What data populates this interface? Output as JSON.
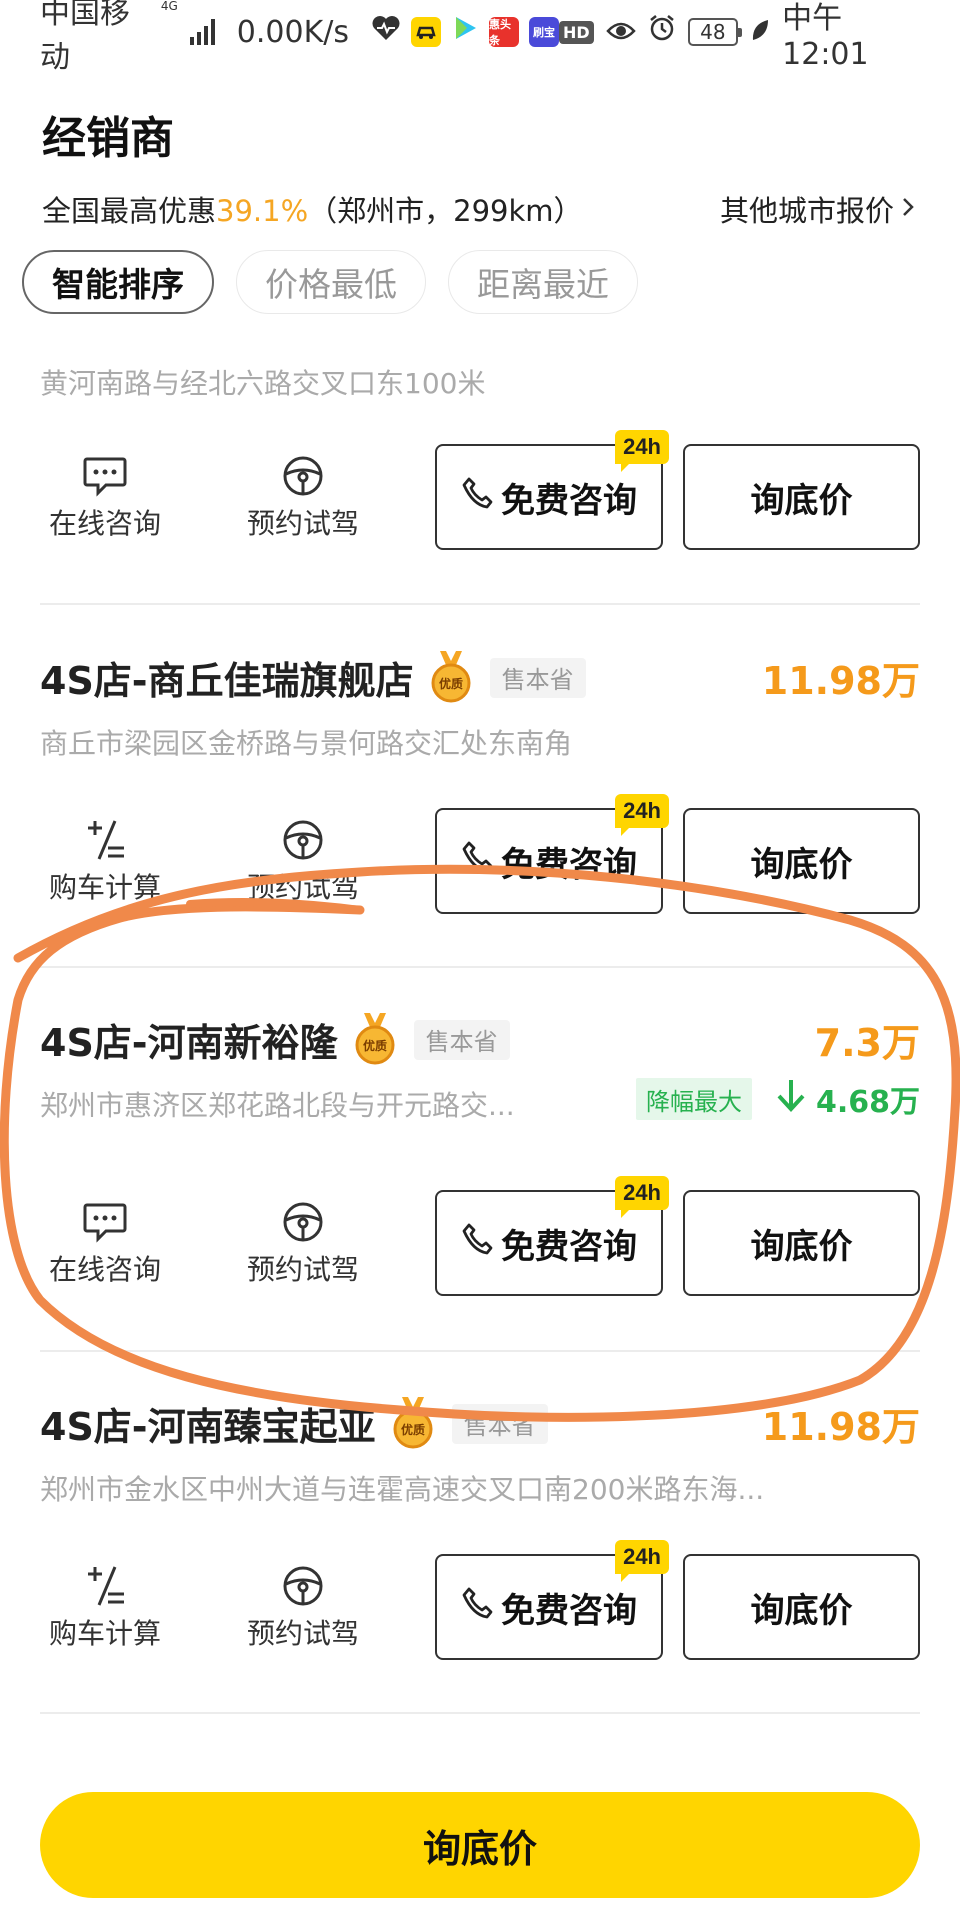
{
  "status_bar": {
    "carrier": "中国移动",
    "network": "4G",
    "speed": "0.00K/s",
    "battery": "48",
    "time": "中午12:01",
    "hd": "HD",
    "app_icons": [
      "health-icon",
      "car-app-icon",
      "video-app-icon",
      "toutiao-app-icon",
      "shuabao-app-icon"
    ],
    "app_labels": {
      "toutiao": "惠头条",
      "shuabao": "刷宝"
    }
  },
  "header": {
    "title": "经销商",
    "promo_prefix": "全国最高优惠",
    "promo_percent": "39.1%",
    "promo_suffix": "（郑州市，299km）",
    "other_city": "其他城市报价"
  },
  "sort_tabs": [
    {
      "label": "智能排序",
      "active": true
    },
    {
      "label": "价格最低",
      "active": false
    },
    {
      "label": "距离最近",
      "active": false
    }
  ],
  "dealers": [
    {
      "address": "黄河南路与经北六路交叉口东100米",
      "actions": [
        {
          "label": "在线咨询",
          "icon": "chat-icon"
        },
        {
          "label": "预约试驾",
          "icon": "steering-wheel-icon"
        }
      ],
      "free_consult": "免费咨询",
      "badge": "24h",
      "ask_price": "询底价"
    },
    {
      "name": "4S店-商丘佳瑞旗舰店",
      "medal_label": "优质",
      "sell_tag": "售本省",
      "price": "11.98万",
      "address": "商丘市梁园区金桥路与景何路交汇处东南角",
      "actions": [
        {
          "label": "购车计算",
          "icon": "calculator-icon"
        },
        {
          "label": "预约试驾",
          "icon": "steering-wheel-icon"
        }
      ],
      "free_consult": "免费咨询",
      "badge": "24h",
      "ask_price": "询底价"
    },
    {
      "name": "4S店-河南新裕隆",
      "medal_label": "优质",
      "sell_tag": "售本省",
      "price": "7.3万",
      "address": "郑州市惠济区郑花路北段与开元路交...",
      "drop_label": "降幅最大",
      "drop_value": "4.68万",
      "actions": [
        {
          "label": "在线咨询",
          "icon": "chat-icon"
        },
        {
          "label": "预约试驾",
          "icon": "steering-wheel-icon"
        }
      ],
      "free_consult": "免费咨询",
      "badge": "24h",
      "ask_price": "询底价"
    },
    {
      "name": "4S店-河南臻宝起亚",
      "medal_label": "优质",
      "sell_tag": "售本省",
      "price": "11.98万",
      "address": "郑州市金水区中州大道与连霍高速交叉口南200米路东海...",
      "actions": [
        {
          "label": "购车计算",
          "icon": "calculator-icon"
        },
        {
          "label": "预约试驾",
          "icon": "steering-wheel-icon"
        }
      ],
      "free_consult": "免费咨询",
      "badge": "24h",
      "ask_price": "询底价"
    }
  ],
  "bottom_cta": "询底价",
  "colors": {
    "accent_yellow": "#ffd500",
    "price_orange": "#f59a1b",
    "drop_green": "#27b14f",
    "annotation_orange": "#f0894a"
  }
}
